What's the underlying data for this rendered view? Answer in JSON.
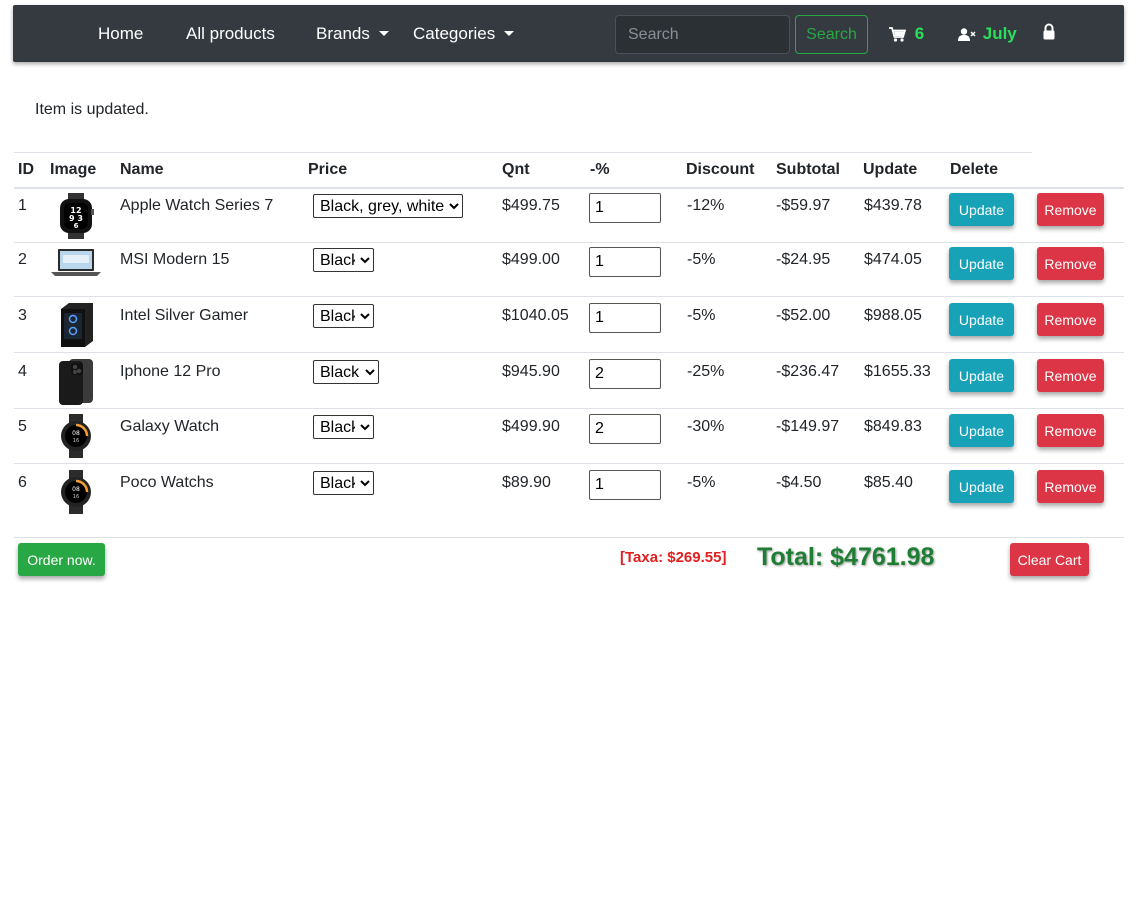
{
  "navbar": {
    "home": "Home",
    "all_products": "All products",
    "brands": "Brands",
    "categories": "Categories",
    "search_placeholder": "Search",
    "search_button": "Search",
    "cart_count": "6",
    "user_name": "July",
    "accent_color": "#28e05a"
  },
  "alert": {
    "message": "Item is updated."
  },
  "table": {
    "headers": [
      "ID",
      "Image",
      "Name",
      "Price",
      "Qnt",
      "-%",
      "Discount",
      "Subtotal",
      "Update",
      "Delete"
    ],
    "rows": [
      {
        "id": "1",
        "image": "smartwatch-image",
        "name": "Apple Watch Series 7",
        "option": "Black, grey, white.",
        "price": "$499.75",
        "qty": "1",
        "pct": "-12%",
        "discount": "-$59.97",
        "subtotal": "$439.78"
      },
      {
        "id": "2",
        "image": "laptop-image",
        "name": "MSI Modern 15",
        "option": "Black",
        "price": "$499.00",
        "qty": "1",
        "pct": "-5%",
        "discount": "-$24.95",
        "subtotal": "$474.05"
      },
      {
        "id": "3",
        "image": "pc-case-image",
        "name": "Intel Silver Gamer",
        "option": "Black",
        "price": "$1040.05",
        "qty": "1",
        "pct": "-5%",
        "discount": "-$52.00",
        "subtotal": "$988.05"
      },
      {
        "id": "4",
        "image": "phone-image",
        "name": "Iphone 12 Pro",
        "option": "Black",
        "price": "$945.90",
        "qty": "2",
        "pct": "-25%",
        "discount": "-$236.47",
        "subtotal": "$1655.33"
      },
      {
        "id": "5",
        "image": "round-watch-image",
        "name": "Galaxy Watch",
        "option": "Black",
        "price": "$499.90",
        "qty": "2",
        "pct": "-30%",
        "discount": "-$149.97",
        "subtotal": "$849.83"
      },
      {
        "id": "6",
        "image": "round-watch-image",
        "name": "Poco Watchs",
        "option": "Black",
        "price": "$89.90",
        "qty": "1",
        "pct": "-5%",
        "discount": "-$4.50",
        "subtotal": "$85.40"
      }
    ],
    "update_label": "Update",
    "remove_label": "Remove"
  },
  "footer": {
    "order_button": "Order now.",
    "taxa": "[Taxa: $269.55]",
    "total": "Total: $4761.98",
    "clear_button": "Clear Cart"
  },
  "colors": {
    "navbar_bg": "#343a40",
    "update_btn": "#17a2b8",
    "remove_btn": "#dc3545",
    "order_btn": "#28a745",
    "total_text": "#1e7e34",
    "taxa_text": "#e02020"
  }
}
